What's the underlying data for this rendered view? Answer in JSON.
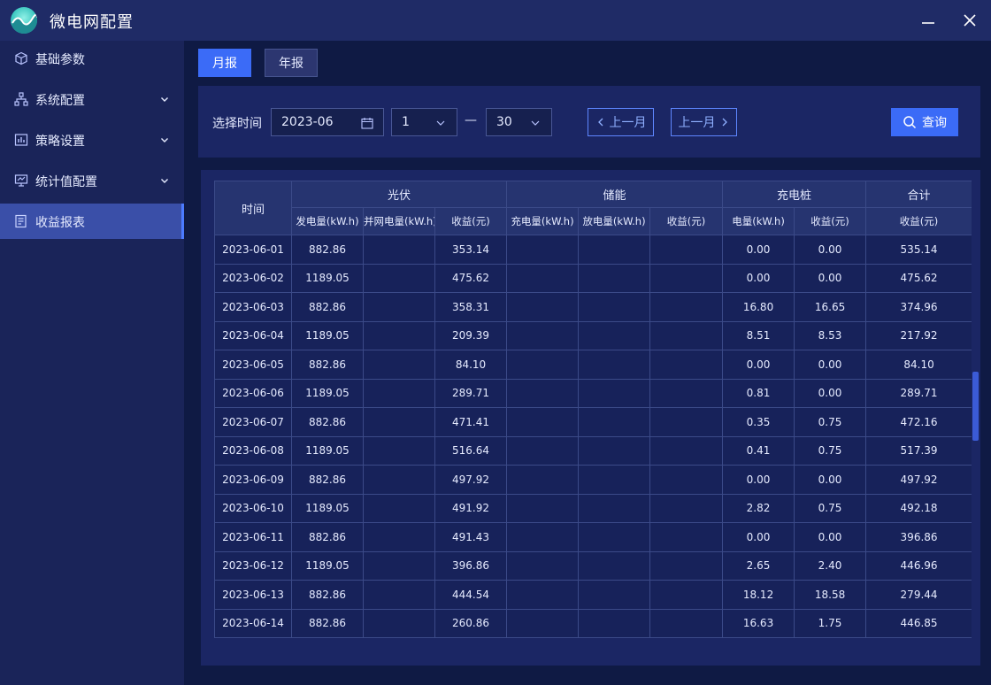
{
  "app": {
    "title": "微电网配置"
  },
  "sidebar": {
    "items": [
      {
        "label": "基础参数",
        "icon": "cube-icon",
        "has_children": false,
        "active": false
      },
      {
        "label": "系统配置",
        "icon": "network-icon",
        "has_children": true,
        "active": false
      },
      {
        "label": "策略设置",
        "icon": "chart-grid-icon",
        "has_children": true,
        "active": false
      },
      {
        "label": "统计值配置",
        "icon": "monitor-icon",
        "has_children": true,
        "active": false
      },
      {
        "label": "收益报表",
        "icon": "report-icon",
        "has_children": false,
        "active": true
      }
    ]
  },
  "tabs": {
    "month": "月报",
    "year": "年报",
    "active": "month"
  },
  "filter": {
    "label": "选择时间",
    "date_value": "2023-06",
    "start_day": "1",
    "end_day": "30",
    "separator": "—",
    "prev_label": "上一月",
    "next_label": "上一月",
    "query_label": "查询"
  },
  "table": {
    "time_header": "时间",
    "groups": {
      "pv": "光伏",
      "storage": "储能",
      "charger": "充电桩",
      "total": "合计"
    },
    "subheaders": {
      "pv_gen": "发电量(kW.h)",
      "pv_grid": "并网电量(kW.h)",
      "pv_income": "收益(元)",
      "st_charge": "充电量(kW.h)",
      "st_discharge": "放电量(kW.h)",
      "st_income": "收益(元)",
      "ch_energy": "电量(kW.h)",
      "ch_income": "收益(元)",
      "total_income": "收益(元)"
    },
    "rows": [
      {
        "date": "2023-06-01",
        "pv_gen": "882.86",
        "pv_grid": "",
        "pv_income": "353.14",
        "st_charge": "",
        "st_discharge": "",
        "st_income": "",
        "ch_energy": "0.00",
        "ch_income": "0.00",
        "total": "535.14"
      },
      {
        "date": "2023-06-02",
        "pv_gen": "1189.05",
        "pv_grid": "",
        "pv_income": "475.62",
        "st_charge": "",
        "st_discharge": "",
        "st_income": "",
        "ch_energy": "0.00",
        "ch_income": "0.00",
        "total": "475.62"
      },
      {
        "date": "2023-06-03",
        "pv_gen": "882.86",
        "pv_grid": "",
        "pv_income": "358.31",
        "st_charge": "",
        "st_discharge": "",
        "st_income": "",
        "ch_energy": "16.80",
        "ch_income": "16.65",
        "total": "374.96"
      },
      {
        "date": "2023-06-04",
        "pv_gen": "1189.05",
        "pv_grid": "",
        "pv_income": "209.39",
        "st_charge": "",
        "st_discharge": "",
        "st_income": "",
        "ch_energy": "8.51",
        "ch_income": "8.53",
        "total": "217.92"
      },
      {
        "date": "2023-06-05",
        "pv_gen": "882.86",
        "pv_grid": "",
        "pv_income": "84.10",
        "st_charge": "",
        "st_discharge": "",
        "st_income": "",
        "ch_energy": "0.00",
        "ch_income": "0.00",
        "total": "84.10"
      },
      {
        "date": "2023-06-06",
        "pv_gen": "1189.05",
        "pv_grid": "",
        "pv_income": "289.71",
        "st_charge": "",
        "st_discharge": "",
        "st_income": "",
        "ch_energy": "0.81",
        "ch_income": "0.00",
        "total": "289.71"
      },
      {
        "date": "2023-06-07",
        "pv_gen": "882.86",
        "pv_grid": "",
        "pv_income": "471.41",
        "st_charge": "",
        "st_discharge": "",
        "st_income": "",
        "ch_energy": "0.35",
        "ch_income": "0.75",
        "total": "472.16"
      },
      {
        "date": "2023-06-08",
        "pv_gen": "1189.05",
        "pv_grid": "",
        "pv_income": "516.64",
        "st_charge": "",
        "st_discharge": "",
        "st_income": "",
        "ch_energy": "0.41",
        "ch_income": "0.75",
        "total": "517.39"
      },
      {
        "date": "2023-06-09",
        "pv_gen": "882.86",
        "pv_grid": "",
        "pv_income": "497.92",
        "st_charge": "",
        "st_discharge": "",
        "st_income": "",
        "ch_energy": "0.00",
        "ch_income": "0.00",
        "total": "497.92"
      },
      {
        "date": "2023-06-10",
        "pv_gen": "1189.05",
        "pv_grid": "",
        "pv_income": "491.92",
        "st_charge": "",
        "st_discharge": "",
        "st_income": "",
        "ch_energy": "2.82",
        "ch_income": "0.75",
        "total": "492.18"
      },
      {
        "date": "2023-06-11",
        "pv_gen": "882.86",
        "pv_grid": "",
        "pv_income": "491.43",
        "st_charge": "",
        "st_discharge": "",
        "st_income": "",
        "ch_energy": "0.00",
        "ch_income": "0.00",
        "total": "396.86"
      },
      {
        "date": "2023-06-12",
        "pv_gen": "1189.05",
        "pv_grid": "",
        "pv_income": "396.86",
        "st_charge": "",
        "st_discharge": "",
        "st_income": "",
        "ch_energy": "2.65",
        "ch_income": "2.40",
        "total": "446.96"
      },
      {
        "date": "2023-06-13",
        "pv_gen": "882.86",
        "pv_grid": "",
        "pv_income": "444.54",
        "st_charge": "",
        "st_discharge": "",
        "st_income": "",
        "ch_energy": "18.12",
        "ch_income": "18.58",
        "total": "279.44"
      },
      {
        "date": "2023-06-14",
        "pv_gen": "882.86",
        "pv_grid": "",
        "pv_income": "260.86",
        "st_charge": "",
        "st_discharge": "",
        "st_income": "",
        "ch_energy": "16.63",
        "ch_income": "1.75",
        "total": "446.85"
      }
    ]
  },
  "colors": {
    "accent": "#3b6bf7",
    "sidebar_bg": "#1a2459",
    "page_bg": "#0f1a44",
    "panel_bg": "#1b2664"
  }
}
